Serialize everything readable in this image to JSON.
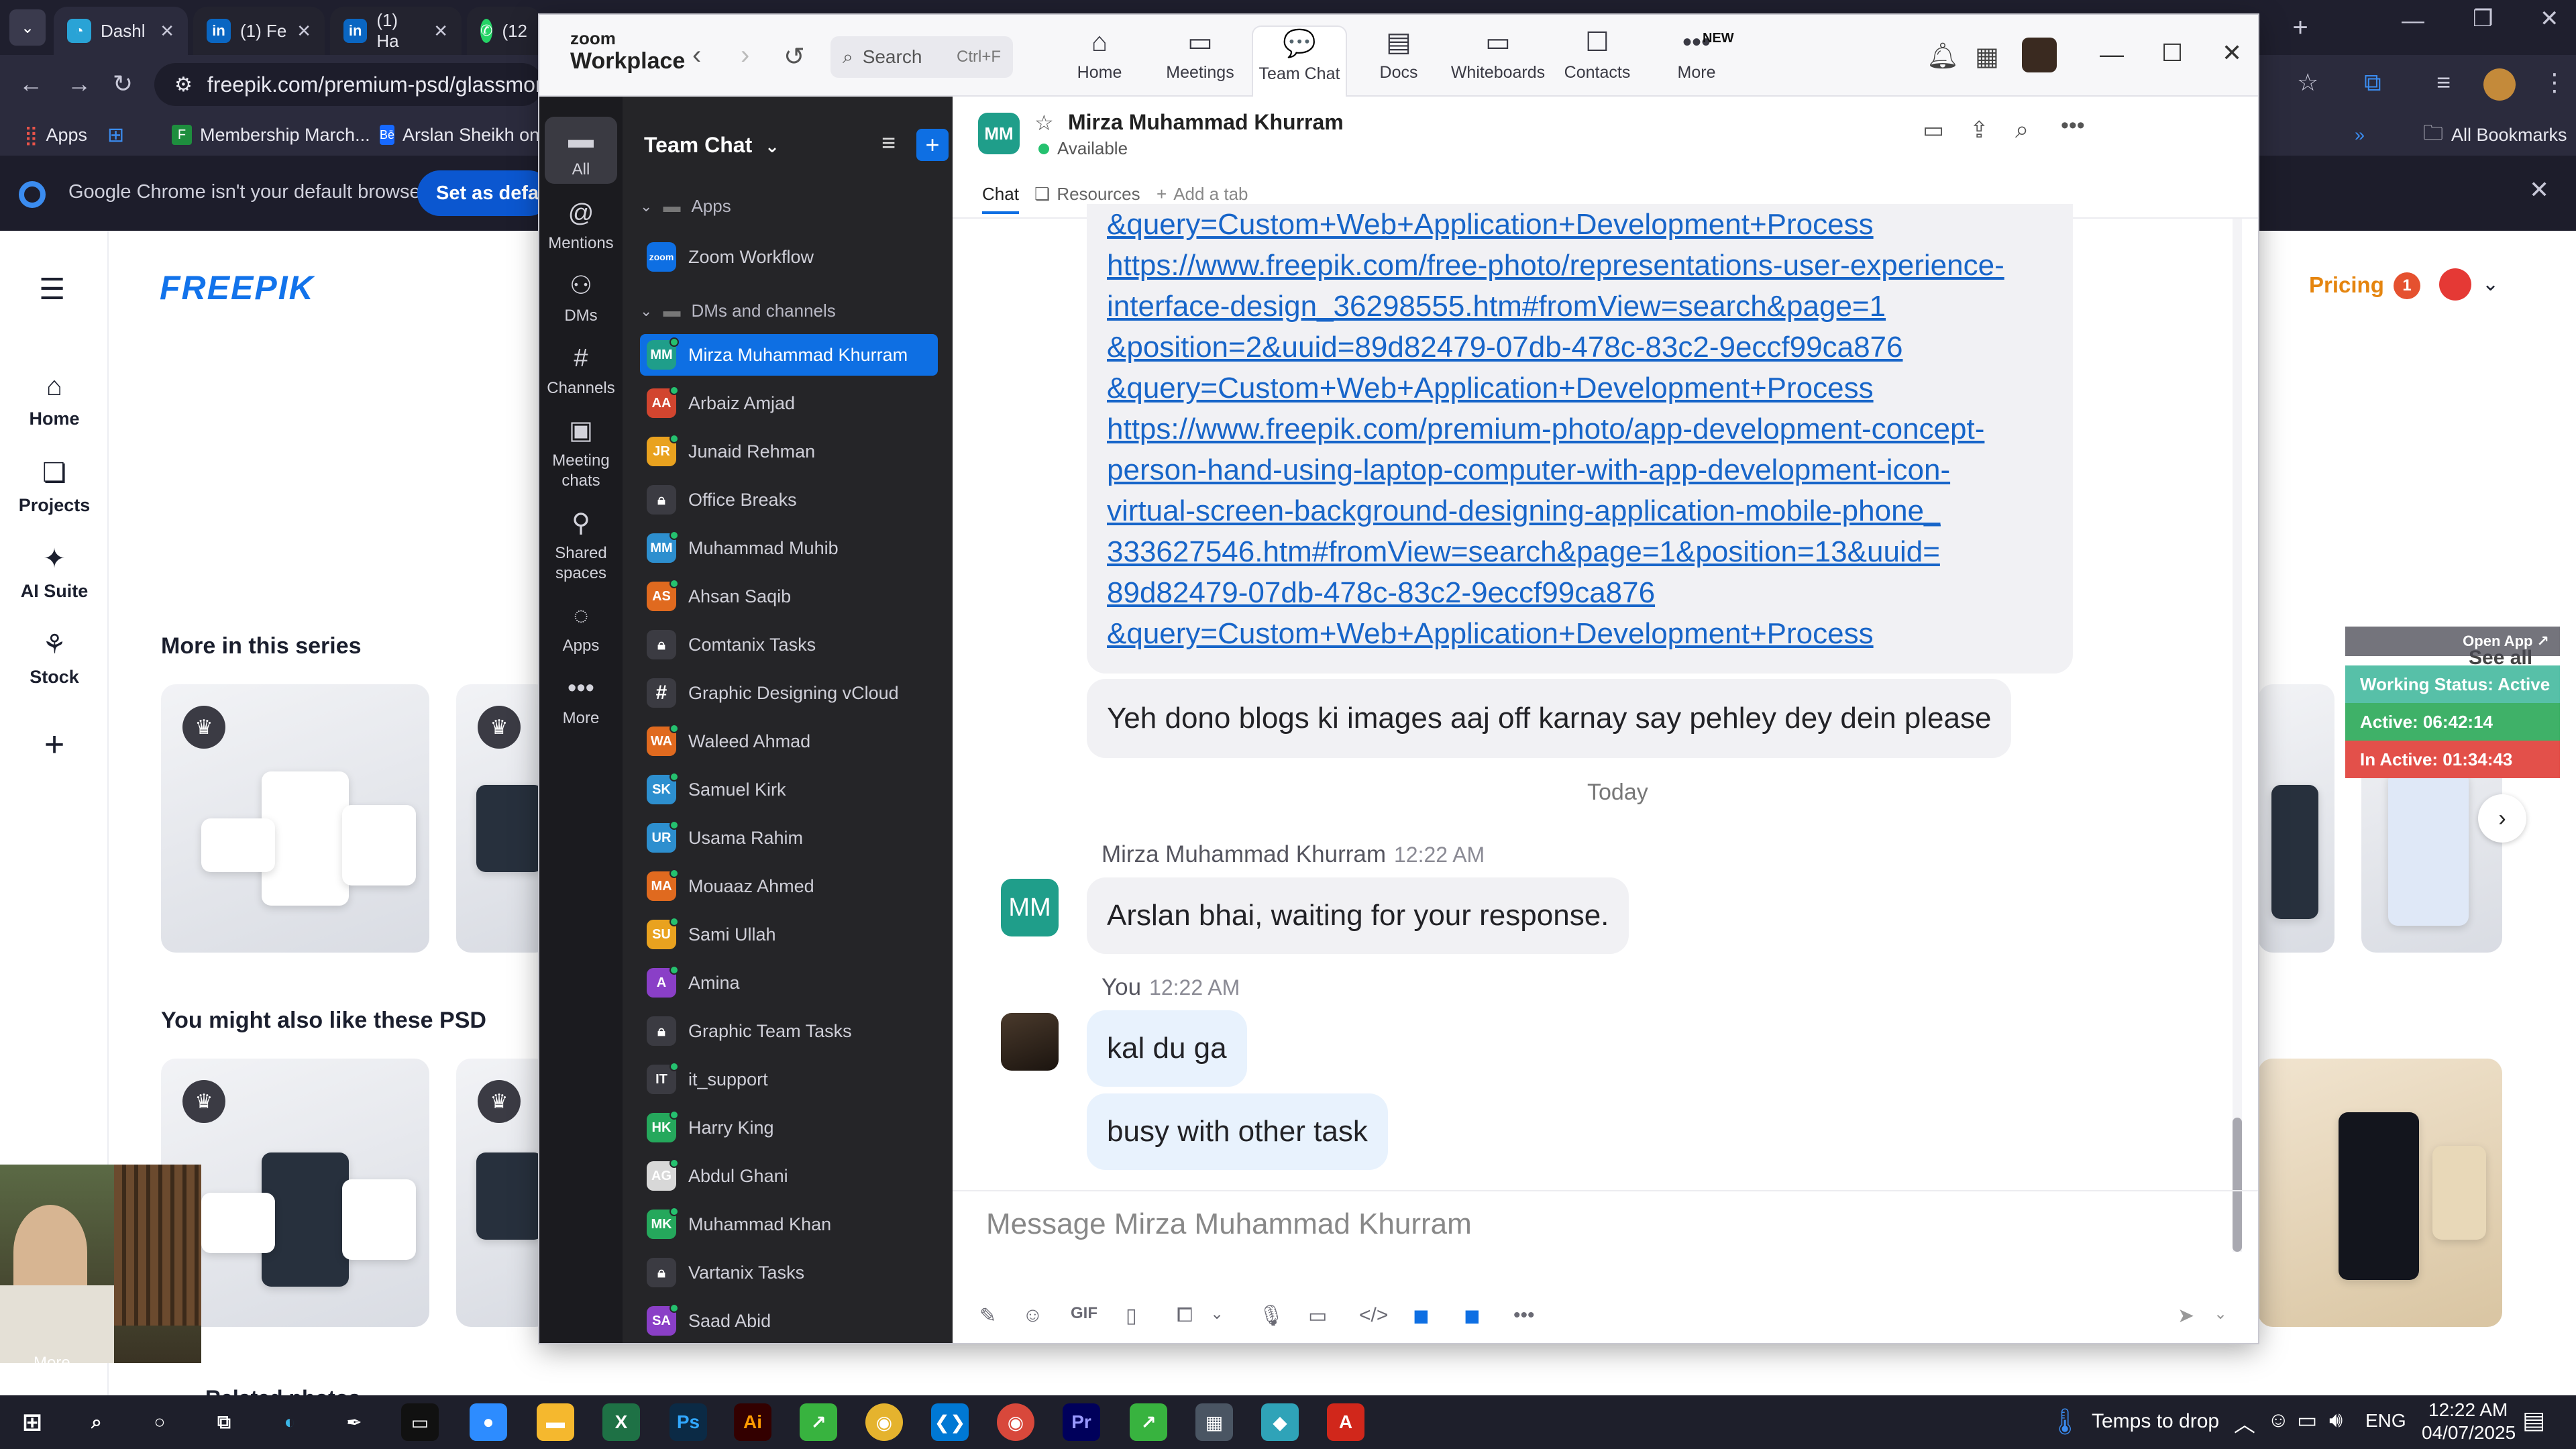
{
  "browser": {
    "tabs": [
      {
        "label": "Dashl",
        "icon": "dashboard-icon"
      },
      {
        "label": "(1) Fe",
        "icon": "linkedin-icon"
      },
      {
        "label": "(1) Ha",
        "icon": "linkedin-icon"
      },
      {
        "label": "(12",
        "icon": "whatsapp-icon"
      }
    ],
    "url": "freepik.com/premium-psd/glassmorphi",
    "bookmarks": {
      "apps": "Apps",
      "membership": "Membership March...",
      "arslan": "Arslan Sheikh on B",
      "all": "All Bookmarks"
    },
    "default_banner": {
      "text": "Google Chrome isn't your default browser",
      "button": "Set as default"
    }
  },
  "freepik": {
    "logo": "FREEPIK",
    "nav": {
      "home": "Home",
      "projects": "Projects",
      "ai_suite": "AI Suite",
      "stock": "Stock"
    },
    "pricing": "Pricing",
    "notifications": "1",
    "more_series": "More in this series",
    "also_like": "You might also like these PSD",
    "see_all": "See all",
    "related": "Related photos",
    "more": "More"
  },
  "zoom": {
    "logo_top": "zoom",
    "logo_bottom": "Workplace",
    "search": {
      "placeholder": "Search",
      "shortcut": "Ctrl+F"
    },
    "tabs": {
      "home": "Home",
      "meetings": "Meetings",
      "team_chat": "Team Chat",
      "docs": "Docs",
      "whiteboards": "Whiteboards",
      "contacts": "Contacts",
      "more": "More",
      "new_badge": "NEW"
    },
    "rail": {
      "all": "All",
      "mentions": "Mentions",
      "dms": "DMs",
      "channels": "Channels",
      "meeting_chats": "Meeting chats",
      "shared_spaces": "Shared spaces",
      "apps": "Apps",
      "more": "More"
    },
    "list": {
      "title": "Team Chat",
      "section_apps": "Apps",
      "zoom_workflow": "Zoom Workflow",
      "section_dms": "DMs and channels",
      "items": [
        {
          "name": "Mirza Muhammad Khurram",
          "initials": "MM",
          "color": "#1f9e8a",
          "kind": "avatar"
        },
        {
          "name": "Arbaiz Amjad",
          "initials": "AA",
          "color": "#d2452f",
          "kind": "avatar"
        },
        {
          "name": "Junaid Rehman",
          "initials": "JR",
          "color": "#e9a21f",
          "kind": "avatar"
        },
        {
          "name": "Office Breaks",
          "initials": "",
          "color": "#3b3b42",
          "kind": "lock"
        },
        {
          "name": "Muhammad Muhib",
          "initials": "MM",
          "color": "#2d8fcf",
          "kind": "avatar"
        },
        {
          "name": "Ahsan Saqib",
          "initials": "AS",
          "color": "#e06a1f",
          "kind": "avatar"
        },
        {
          "name": "Comtanix Tasks",
          "initials": "",
          "color": "#3b3b42",
          "kind": "lock"
        },
        {
          "name": "Graphic Designing vCloud",
          "initials": "#",
          "color": "#3b3b42",
          "kind": "hash"
        },
        {
          "name": "Waleed Ahmad",
          "initials": "WA",
          "color": "#e06a1f",
          "kind": "avatar"
        },
        {
          "name": "Samuel Kirk",
          "initials": "SK",
          "color": "#2d8fcf",
          "kind": "avatar"
        },
        {
          "name": "Usama Rahim",
          "initials": "UR",
          "color": "#2d8fcf",
          "kind": "avatar"
        },
        {
          "name": "Mouaaz Ahmed",
          "initials": "MA",
          "color": "#e06a1f",
          "kind": "avatar"
        },
        {
          "name": "Sami Ullah",
          "initials": "SU",
          "color": "#e9a21f",
          "kind": "avatar"
        },
        {
          "name": "Amina",
          "initials": "A",
          "color": "#8a3fc7",
          "kind": "avatar"
        },
        {
          "name": "Graphic Team Tasks",
          "initials": "",
          "color": "#3b3b42",
          "kind": "lock"
        },
        {
          "name": "it_support",
          "initials": "IT",
          "color": "#3b3b42",
          "kind": "avatar"
        },
        {
          "name": "Harry King",
          "initials": "HK",
          "color": "#25a85c",
          "kind": "avatar"
        },
        {
          "name": "Abdul Ghani",
          "initials": "AG",
          "color": "#d8d8d8",
          "kind": "avatar"
        },
        {
          "name": "Muhammad Khan",
          "initials": "MK",
          "color": "#25a85c",
          "kind": "avatar"
        },
        {
          "name": "Vartanix Tasks",
          "initials": "",
          "color": "#3b3b42",
          "kind": "lock"
        },
        {
          "name": "Saad Abid",
          "initials": "SA",
          "color": "#8a3fc7",
          "kind": "avatar"
        }
      ]
    },
    "chat": {
      "contact_name": "Mirza Muhammad Khurram",
      "contact_initials": "MM",
      "status": "Available",
      "tabs": {
        "chat": "Chat",
        "resources": "Resources",
        "add_tab": "Add a tab"
      },
      "links": [
        "&query=Custom+Web+Application+Development+Process",
        "https://www.freepik.com/free-photo/representations-user-experience-",
        "interface-design_36298555.htm#fromView=search&page=1",
        "&position=2&uuid=89d82479-07db-478c-83c2-9eccf99ca876",
        "&query=Custom+Web+Application+Development+Process",
        "https://www.freepik.com/premium-photo/app-development-concept-",
        "person-hand-using-laptop-computer-with-app-development-icon-",
        "virtual-screen-background-designing-application-mobile-phone_",
        "333627546.htm#fromView=search&page=1&position=13&uuid=",
        "89d82479-07db-478c-83c2-9eccf99ca876",
        "&query=Custom+Web+Application+Development+Process"
      ],
      "prev_message": "Yeh dono blogs ki images aaj off karnay say pehley dey dein please",
      "day_divider": "Today",
      "msg1": {
        "sender": "Mirza Muhammad Khurram",
        "time": "12:22 AM",
        "text": "Arslan bhai, waiting for your response."
      },
      "msg2": {
        "sender": "You",
        "time": "12:22 AM",
        "text1": "kal du ga",
        "text2": "busy with other task"
      },
      "composer_placeholder": "Message Mirza Muhammad Khurram"
    }
  },
  "status_widget": {
    "open_app": "Open App ↗",
    "working": "Working Status: Active",
    "active": "Active: 06:42:14",
    "inactive": "In Active: 01:34:43"
  },
  "taskbar": {
    "drop_text": "Temps to drop",
    "lang": "ENG",
    "time": "12:22 AM",
    "date": "04/07/2025"
  }
}
